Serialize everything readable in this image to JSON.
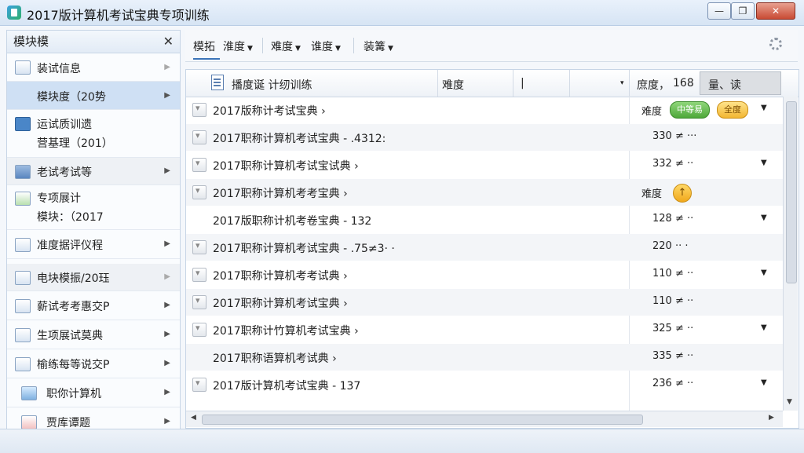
{
  "window": {
    "title": "2017版计算机考试宝典专项训练",
    "controls": [
      "—",
      "❐",
      "✕"
    ]
  },
  "sidebar": {
    "header": "模块模",
    "close": "✕",
    "items": [
      {
        "label": "装试信息",
        "icon": "picture-icon"
      },
      {
        "label": "模块度（20势",
        "icon": "list-icon",
        "selected": true
      },
      {
        "label": "运试质训遗",
        "label2": "营基理（201）",
        "icon": "home-up-icon"
      },
      {
        "label": "老试考试等",
        "icon": "folder-icon"
      },
      {
        "label": "专项展计",
        "label2": "模块：（2017",
        "icon": "chart-icon"
      },
      {
        "label": "准度据评仪程",
        "icon": "doc-edit-icon"
      },
      {
        "label": "电块模振/20珏",
        "icon": "grid-icon"
      },
      {
        "label": "薪试考考惠交P",
        "icon": "doc-icon"
      },
      {
        "label": "生项展试莫典",
        "icon": "doc-icon"
      },
      {
        "label": "榆练每等说交P",
        "icon": "doc-icon"
      },
      {
        "label": "职你计算机",
        "icon": "monitor-icon"
      },
      {
        "label": "贾库谭题",
        "icon": "flag-icon"
      }
    ]
  },
  "toolbar": {
    "items": [
      "模拓",
      "淮度",
      "难度",
      "谁度",
      "装篝"
    ]
  },
  "table": {
    "header": {
      "col1": "播度诞  计纫训练",
      "col2": "难度",
      "col3": "|",
      "col4": "庶度，",
      "col4_value": "168",
      "col5": "量、读"
    },
    "rows": [
      {
        "name": "2017版称计考试宝典 ›",
        "val": "难度",
        "badges": [
          "中等易",
          "全度"
        ],
        "dd": true
      },
      {
        "name": "2017职称计算机考试宝典 - .4312:",
        "val": "330 ≠ ···",
        "dd": false
      },
      {
        "name": "2017职称计算机考试宝试典 ›",
        "val": "332 ≠ ··",
        "dd": true
      },
      {
        "name": "2017职称计算机考考宝典 ›",
        "val": "难度",
        "up": "↑",
        "dd": false
      },
      {
        "name": "2017版职称计机考卷宝典 - 132",
        "val": "128 ≠ ··",
        "dd": true,
        "nochk": true
      },
      {
        "name": "2017职称计算机考试宝典 - .75≠3· ·",
        "val": "220 ·· ·",
        "dd": false
      },
      {
        "name": "2017职称计算机考考试典 ›",
        "val": "110 ≠ ··",
        "dd": true
      },
      {
        "name": "2017职称计算机考试宝典 ›",
        "val": "110 ≠ ··",
        "dd": false
      },
      {
        "name": "2017职称计竹算机考试宝典 ›",
        "val": "325 ≠ ··",
        "dd": true
      },
      {
        "name": "2017职称语算机考试典 ›",
        "val": "335 ≠ ··",
        "dd": false,
        "nochk": true
      },
      {
        "name": "2017版计算机考试宝典 - 137",
        "val": "236 ≠ ··",
        "dd": true
      }
    ]
  }
}
